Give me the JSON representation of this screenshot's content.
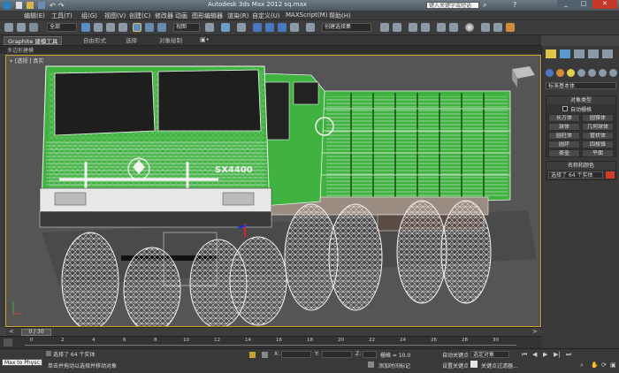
{
  "window": {
    "title": "Autodesk 3ds Max  2012      sq.max"
  },
  "menubar": {
    "items": [
      "编辑(E)",
      "工具(T)",
      "组(G)",
      "视图(V)",
      "创建(C)",
      "修改器",
      "动画",
      "图形编辑器",
      "渲染(R)",
      "自定义(U)",
      "MAXScript(M)",
      "帮助(H)"
    ]
  },
  "search": {
    "placeholder": "键入关键字或短语"
  },
  "toolbar": {
    "selection_filter": "全部",
    "view_coord": "视图",
    "named_selection": "创建选择集"
  },
  "ribbon": {
    "tabs": [
      "Graphite 建模工具",
      "自由形式",
      "选择",
      "对象绘制"
    ],
    "sub_label": "多边形建模"
  },
  "viewport": {
    "label": "+ [透视 ] 真实",
    "logo_text": "SX4400"
  },
  "command_panel": {
    "dropdown": "标准基本体",
    "object_type_title": "对象类型",
    "autogrid_label": "自动栅格",
    "buttons": [
      "长方体",
      "圆锥体",
      "球体",
      "几何球体",
      "圆柱体",
      "管状体",
      "圆环",
      "四棱锥",
      "茶壶",
      "平面"
    ],
    "name_color_title": "名称和颜色",
    "name_value": "选择了 64 个实体"
  },
  "timeline": {
    "frame_counter": "0 / 30",
    "ticks": [
      "0",
      "2",
      "4",
      "6",
      "8",
      "10",
      "12",
      "14",
      "16",
      "18",
      "20",
      "22",
      "24",
      "26",
      "28",
      "30"
    ]
  },
  "status": {
    "listener": "Max to Physc:",
    "selected_msg": "选择了 64 个实体",
    "prompt_msg": "单击并拖动以选择并移动对象",
    "x_label": "X:",
    "y_label": "Y:",
    "z_label": "Z:",
    "grid": "栅格 = 10.0",
    "add_tag": "添加时间标记",
    "auto_key": "自动关键点",
    "set_key": "设置关键点",
    "selected_dd": "选定对象",
    "key_filters": "关键点过滤器..."
  },
  "colors": {
    "accent_border": "#c8a030",
    "model_green": "#3fb23f",
    "wire": "#f2f2f2"
  }
}
